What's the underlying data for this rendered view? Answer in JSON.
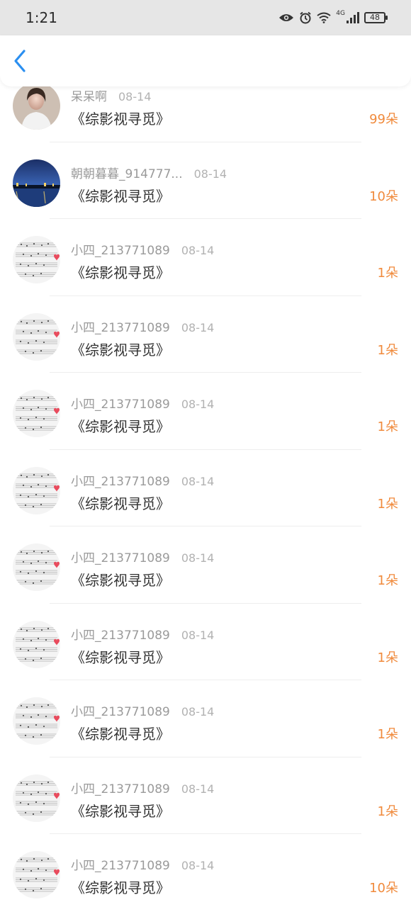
{
  "status_bar": {
    "time": "1:21",
    "network": "4G",
    "battery": "48"
  },
  "header": {
    "back_icon": "chevron-left-icon"
  },
  "rows": [
    {
      "username": "呆呆啊",
      "date": "08-14",
      "title": "《综影视寻觅》",
      "count": "99朵",
      "avatar": "portrait"
    },
    {
      "username": "朝朝暮暮_914777...",
      "date": "08-14",
      "title": "《综影视寻觅》",
      "count": "10朵",
      "avatar": "night-landscape"
    },
    {
      "username": "小四_213771089",
      "date": "08-14",
      "title": "《综影视寻觅》",
      "count": "1朵",
      "avatar": "sheet-music"
    },
    {
      "username": "小四_213771089",
      "date": "08-14",
      "title": "《综影视寻觅》",
      "count": "1朵",
      "avatar": "sheet-music"
    },
    {
      "username": "小四_213771089",
      "date": "08-14",
      "title": "《综影视寻觅》",
      "count": "1朵",
      "avatar": "sheet-music"
    },
    {
      "username": "小四_213771089",
      "date": "08-14",
      "title": "《综影视寻觅》",
      "count": "1朵",
      "avatar": "sheet-music"
    },
    {
      "username": "小四_213771089",
      "date": "08-14",
      "title": "《综影视寻觅》",
      "count": "1朵",
      "avatar": "sheet-music"
    },
    {
      "username": "小四_213771089",
      "date": "08-14",
      "title": "《综影视寻觅》",
      "count": "1朵",
      "avatar": "sheet-music"
    },
    {
      "username": "小四_213771089",
      "date": "08-14",
      "title": "《综影视寻觅》",
      "count": "1朵",
      "avatar": "sheet-music"
    },
    {
      "username": "小四_213771089",
      "date": "08-14",
      "title": "《综影视寻觅》",
      "count": "1朵",
      "avatar": "sheet-music"
    },
    {
      "username": "小四_213771089",
      "date": "08-14",
      "title": "《综影视寻觅》",
      "count": "10朵",
      "avatar": "sheet-music"
    }
  ],
  "colors": {
    "accent": "#2b8ff0",
    "count": "#f08a3c"
  }
}
